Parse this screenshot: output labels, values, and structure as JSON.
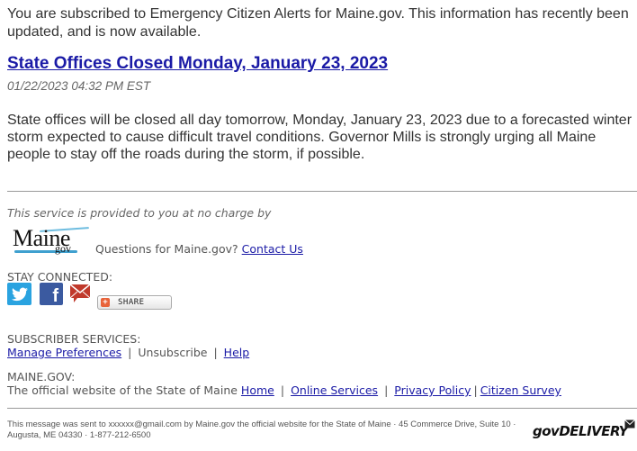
{
  "intro": "You are subscribed to Emergency Citizen Alerts for Maine.gov. This information has recently been updated, and is now available.",
  "article": {
    "title": "State Offices Closed Monday, January 23, 2023",
    "date": "01/22/2023 04:32 PM EST",
    "body": "State offices will be closed all day tomorrow, Monday, January 23, 2023 due to a forecasted winter storm expected to cause difficult travel conditions. Governor Mills is strongly urging all Maine people to stay off the roads during the storm, if possible."
  },
  "provider": {
    "note": "This service is provided to you at no charge by",
    "logo_main": "Maine",
    "logo_sub": "gov",
    "questions": "Questions for Maine.gov?",
    "contact_link": "Contact Us"
  },
  "social": {
    "heading": "STAY CONNECTED:",
    "icons": [
      "twitter-icon",
      "facebook-icon",
      "email-icon"
    ],
    "share_label": "SHARE"
  },
  "subscriber": {
    "heading": "SUBSCRIBER SERVICES:",
    "manage": "Manage Preferences",
    "unsubscribe": "Unsubscribe",
    "help": "Help",
    "separator": "|"
  },
  "mainegov": {
    "heading": "MAINE.GOV:",
    "description": "The official website of the State of Maine",
    "links": [
      "Home",
      "Online Services",
      "Privacy Policy",
      "Citizen Survey"
    ]
  },
  "footer": {
    "text": "This message was sent to xxxxxx@gmail.com by Maine.gov the official website for the State of Maine · 45 Commerce Drive, Suite 10 · Augusta, ME 04330 · 1-877-212-6500",
    "brand": "govDELIVERY"
  }
}
